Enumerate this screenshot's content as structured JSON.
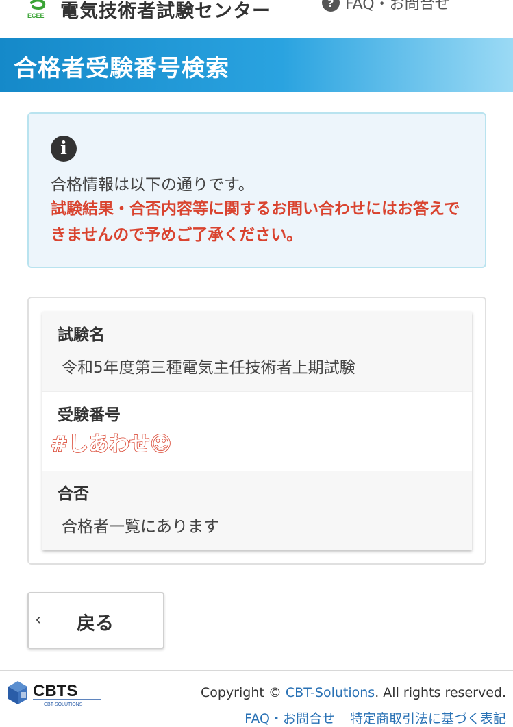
{
  "header": {
    "site_name": "電気技術者試験センター",
    "logo_text": "ECEE",
    "nav_label": "FAQ・お問合せ",
    "nav_icon": "question-circle-icon"
  },
  "title": "合格者受験番号検索",
  "alert": {
    "icon": "info-circle-icon",
    "message": "合格情報は以下の通りです。",
    "warning": "試験結果・合否内容等に関するお問い合わせにはお答えできませんので予めご了承ください。"
  },
  "result": {
    "exam_label": "試験名",
    "exam_value": "令和5年度第三種電気主任技術者上期試験",
    "number_label": "受験番号",
    "number_handwritten": "#しあわせ☺",
    "result_label": "合否",
    "result_value": "合格者一覧にあります"
  },
  "back_button": {
    "icon": "chevron-left-icon",
    "label": "戻る"
  },
  "footer": {
    "logo_text": "CBTS",
    "logo_sub": "CBT-SOLUTIONS",
    "copyright_prefix": "Copyright © ",
    "copyright_link": "CBT-Solutions",
    "copyright_suffix": ". All rights reserved.",
    "link_faq": "FAQ・お問合せ",
    "link_law": "特定商取引法に基づく表記"
  },
  "colors": {
    "title_band": "#1589c9",
    "warning": "#d9432f",
    "link": "#2a72b5",
    "logo_green": "#3aa335"
  }
}
